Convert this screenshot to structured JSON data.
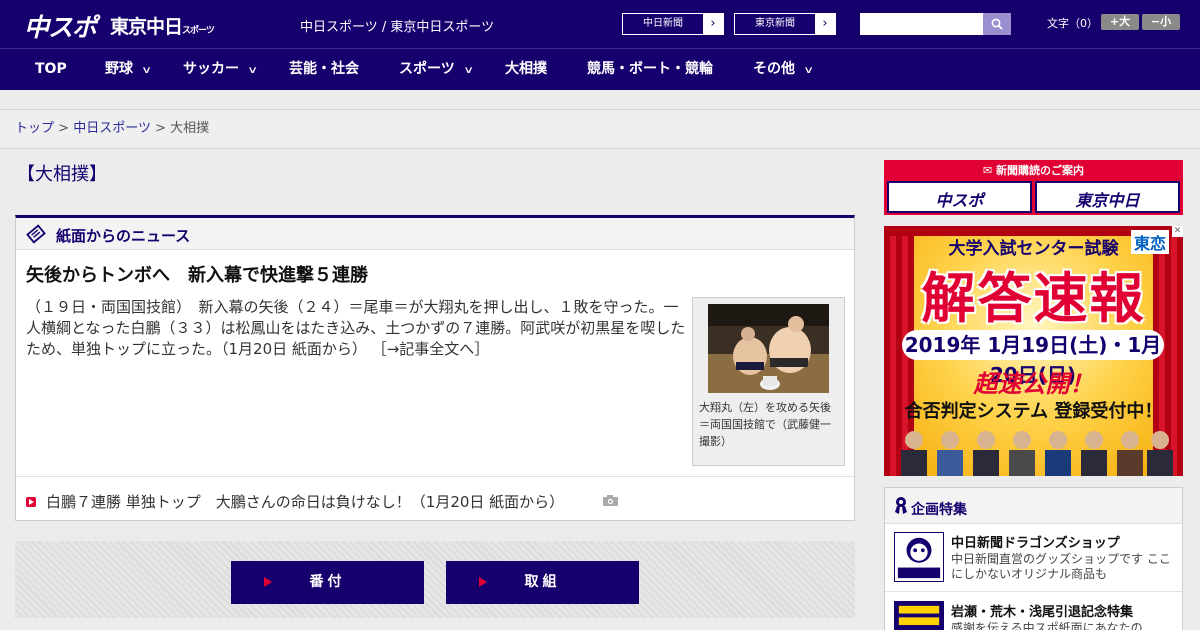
{
  "header": {
    "logo_chuspo": "中スポ",
    "logo_tokyo": "東京中日",
    "logo_tokyo_suffix": "スポーツ",
    "tagline": "中日スポーツ / 東京中日スポーツ",
    "ext_links": [
      {
        "label": "中日新聞"
      },
      {
        "label": "東京新聞"
      }
    ],
    "search": {
      "placeholder": "",
      "value": ""
    },
    "text_size": {
      "label": "文字（0）",
      "larger": "+大",
      "smaller": "−小"
    }
  },
  "nav": [
    {
      "label": "TOP",
      "has_menu": false
    },
    {
      "label": "野球",
      "has_menu": true
    },
    {
      "label": "サッカー",
      "has_menu": true
    },
    {
      "label": "芸能・社会",
      "has_menu": false
    },
    {
      "label": "スポーツ",
      "has_menu": true
    },
    {
      "label": "大相撲",
      "has_menu": false
    },
    {
      "label": "競馬・ボート・競輪",
      "has_menu": false
    },
    {
      "label": "その他",
      "has_menu": true
    }
  ],
  "breadcrumb": {
    "items": [
      "トップ",
      "中日スポーツ"
    ],
    "current": "大相撲",
    "separator": ">"
  },
  "page_title": "【大相撲】",
  "news": {
    "section_label": "紙面からのニュース",
    "headline": "矢後からトンボへ　新入幕で快進撃５連勝",
    "body": "（１９日・両国国技館）　新入幕の矢後（２４）＝尾車＝が大翔丸を押し出し、１敗を守った。一人横綱となった白鵬（３３）は松鳳山をはたき込み、土つかずの７連勝。阿武咲が初黒星を喫したため、単独トップに立った。（1月20日 紙面から）",
    "more_link": "［→記事全文へ］",
    "photo_caption": "大翔丸（左）を攻める矢後＝両国国技館で（武藤健一撮影）",
    "related": "白鵬７連勝 単独トップ　大鵬さんの命日は負けなし！（1月20日 紙面から）"
  },
  "buttons": {
    "banzuke": "番付",
    "torikumi": "取組"
  },
  "sidebar": {
    "subscription": {
      "heading": "新聞購読のご案内",
      "left": "中スポ",
      "right": "東京中日"
    },
    "ad": {
      "exam": "大学入試センター試験",
      "brand": "東恋",
      "headline": "解答速報",
      "dates": "2019年 1月19日(土)・1月20日(日)",
      "fast": "超速公開！",
      "system": "合否判定システム 登録受付中！",
      "close": "✕"
    },
    "features": {
      "heading": "企画特集",
      "items": [
        {
          "title": "中日新聞ドラゴンズショップ",
          "desc": "中日新聞直営のグッズショップです ここにしかないオリジナル商品も"
        },
        {
          "title": "岩瀬・荒木・浅尾引退記念特集",
          "desc": "感謝を伝える中スポ紙面にあなたの"
        }
      ]
    }
  },
  "colors": {
    "brand_navy": "#16006e",
    "accent_red": "#e00034",
    "search_button": "#9a90d0"
  }
}
